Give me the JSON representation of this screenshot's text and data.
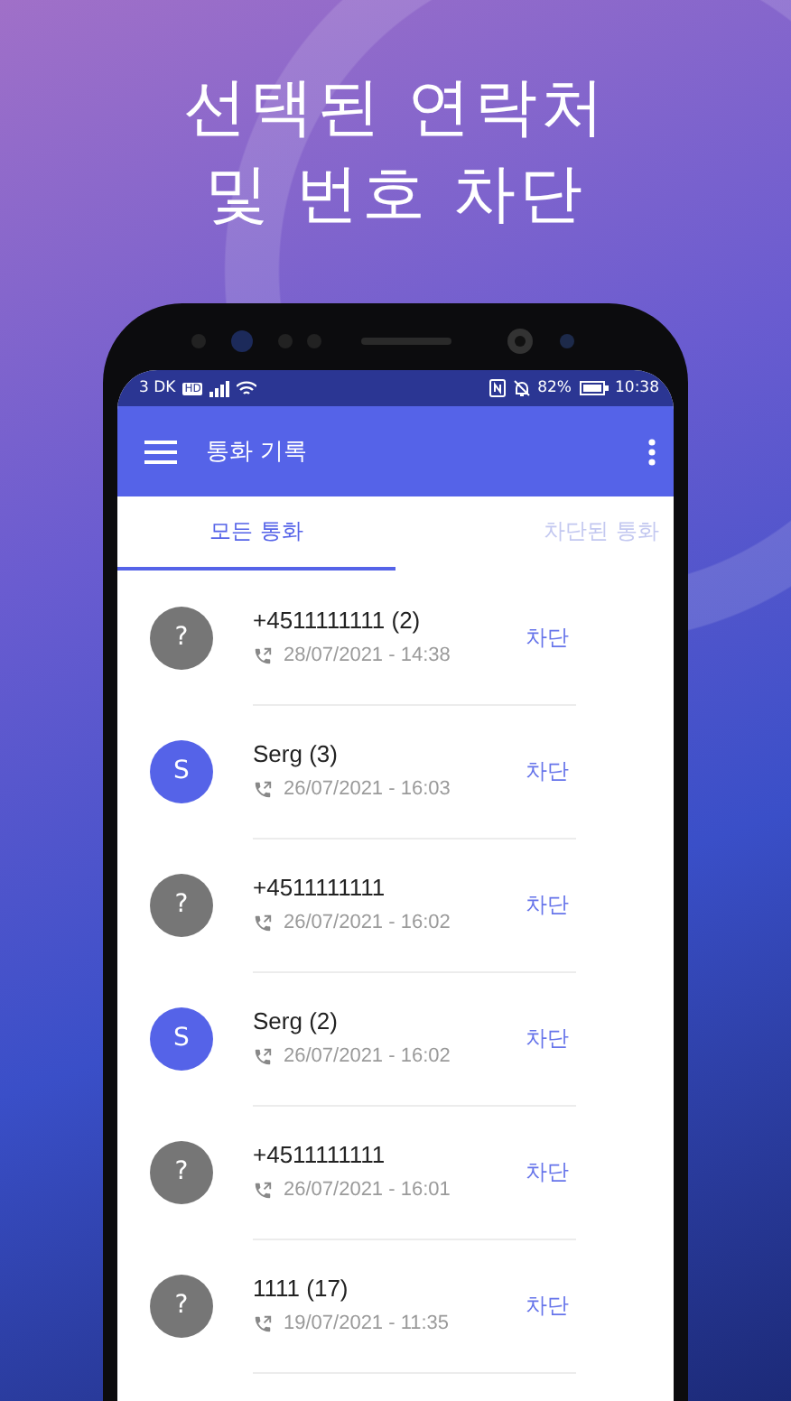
{
  "headline": {
    "lines": [
      "선택된 연락처",
      "및 번호 차단"
    ]
  },
  "status_bar": {
    "carrier": "3 DK",
    "network_badge": "HD",
    "battery_percent": "82%",
    "time": "10:38"
  },
  "app_bar": {
    "title": "통화 기록"
  },
  "tabs": [
    {
      "label": "모든 통화",
      "selected": true
    },
    {
      "label": "차단된 통화",
      "selected": false
    }
  ],
  "calls": [
    {
      "kind": "unknown",
      "avatar": "?",
      "name": "+4511111111 (2)",
      "date": "28/07/2021 - 14:38",
      "action": "차단"
    },
    {
      "kind": "contact",
      "avatar": "S",
      "name": "Serg (3)",
      "date": "26/07/2021 - 16:03",
      "action": "차단"
    },
    {
      "kind": "unknown",
      "avatar": "?",
      "name": "+4511111111",
      "date": "26/07/2021 - 16:02",
      "action": "차단"
    },
    {
      "kind": "contact",
      "avatar": "S",
      "name": "Serg (2)",
      "date": "26/07/2021 - 16:02",
      "action": "차단"
    },
    {
      "kind": "unknown",
      "avatar": "?",
      "name": "+4511111111",
      "date": "26/07/2021 - 16:01",
      "action": "차단"
    },
    {
      "kind": "unknown",
      "avatar": "?",
      "name": "1111 (17)",
      "date": "19/07/2021 - 11:35",
      "action": "차단"
    }
  ]
}
